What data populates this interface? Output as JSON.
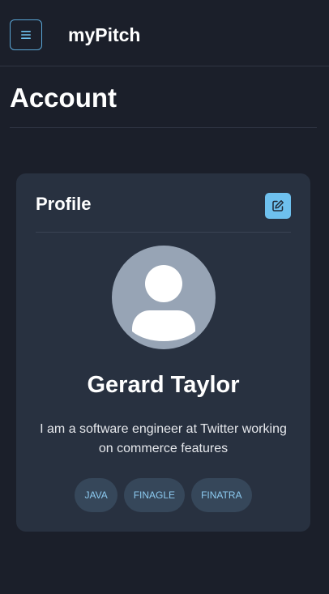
{
  "header": {
    "brand": "myPitch",
    "menu_icon": "hamburger-menu-icon"
  },
  "page": {
    "title": "Account"
  },
  "profile": {
    "card_title": "Profile",
    "edit_icon": "edit-icon",
    "avatar_icon": "user-silhouette-icon",
    "name": "Gerard Taylor",
    "bio": "I am a software engineer at Twitter working on commerce features",
    "tags": [
      "JAVA",
      "FINAGLE",
      "FINATRA"
    ]
  },
  "colors": {
    "background": "#1b1f2a",
    "card": "#283140",
    "accent": "#6ec0ee",
    "tag_bg": "#36475a",
    "tag_text": "#8ccaf0",
    "avatar_bg": "#97a4b5"
  }
}
